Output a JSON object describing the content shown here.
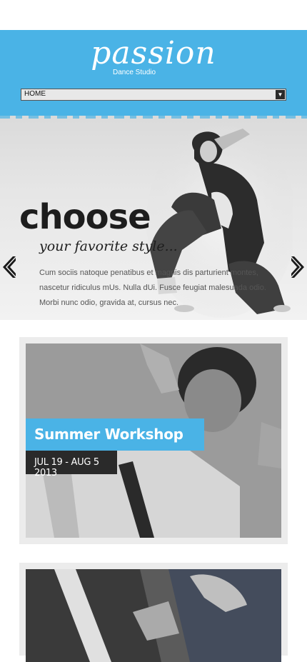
{
  "header": {
    "logo_title": "passion",
    "logo_subtitle": "Dance Studio",
    "menu_selected": "HOME"
  },
  "slider": {
    "heading": "choose",
    "subheading": "your favorite style...",
    "text": "Cum sociis natoque penatibus et magnis dis parturient montes, nascetur ridiculus mUs. Nulla dUi. Fusce feugiat malesuada odio. Morbi nunc odio, gravida at, cursus nec.",
    "prev_icon": "chevron-left-icon",
    "next_icon": "chevron-right-icon"
  },
  "cards": [
    {
      "title": "Summer Workshop",
      "date": "JUL 19 - AUG 5 2013"
    },
    {
      "title": "",
      "date": ""
    }
  ],
  "colors": {
    "accent": "#4ab3e6",
    "dark": "#2a2a2a",
    "card_bg": "#ececec"
  }
}
